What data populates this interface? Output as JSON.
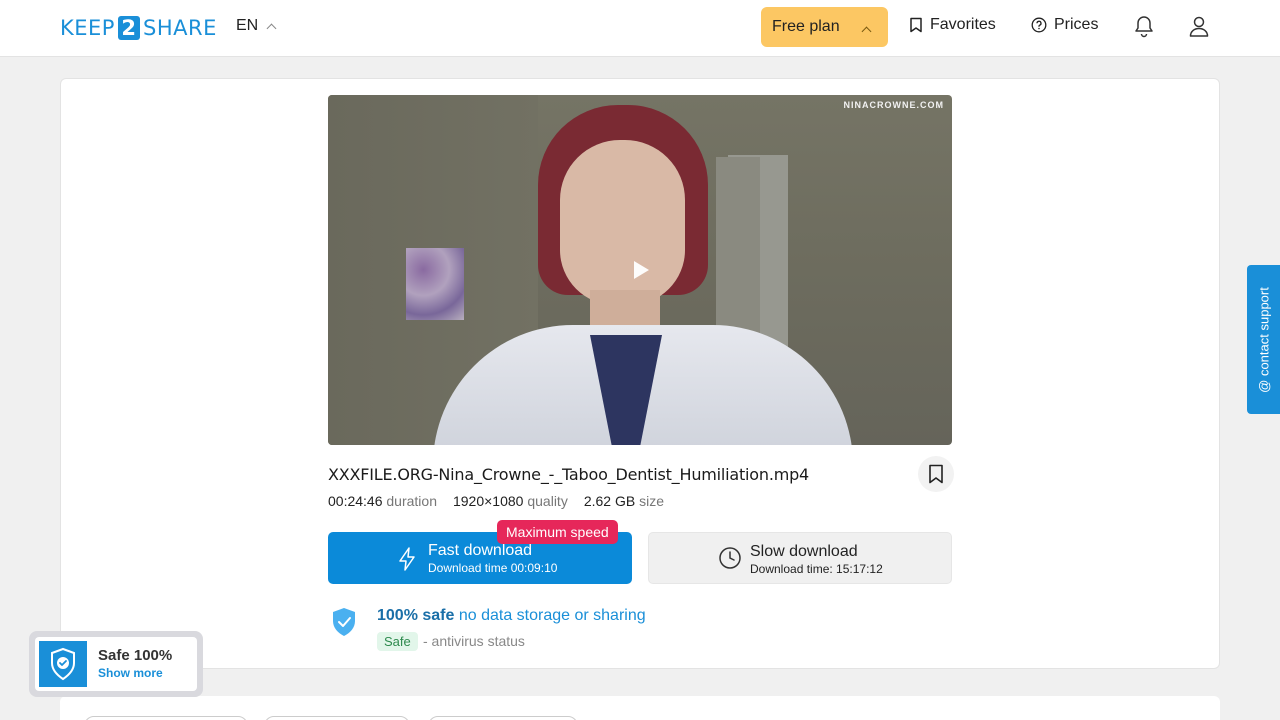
{
  "header": {
    "logo_left": "KEEP",
    "logo_num": "2",
    "logo_right": "SHARE",
    "lang": "EN",
    "plan": "Free plan",
    "favorites": "Favorites",
    "prices": "Prices"
  },
  "video": {
    "watermark": "NINACROWNE.COM"
  },
  "file": {
    "name": "XXXFILE.ORG-Nina_Crowne_-_Taboo_Dentist_Humiliation.mp4",
    "duration_value": "00:24:46",
    "duration_label": "duration",
    "quality_value": "1920×1080",
    "quality_label": "quality",
    "size_value": "2.62 GB",
    "size_label": "size"
  },
  "download": {
    "badge": "Maximum speed",
    "fast_title": "Fast download",
    "fast_sub": "Download time 00:09:10",
    "slow_title": "Slow download",
    "slow_sub": "Download time: 15:17:12"
  },
  "safety": {
    "title_bold": "100% safe",
    "title_rest": "no data storage or sharing",
    "pill": "Safe",
    "antivirus": "- antivirus status"
  },
  "contact": "@ contact support",
  "widget": {
    "title": "Safe 100%",
    "more": "Show more"
  },
  "colors": {
    "brand": "#1a8fd8",
    "plan": "#fcc763",
    "badge": "#e6275a"
  }
}
